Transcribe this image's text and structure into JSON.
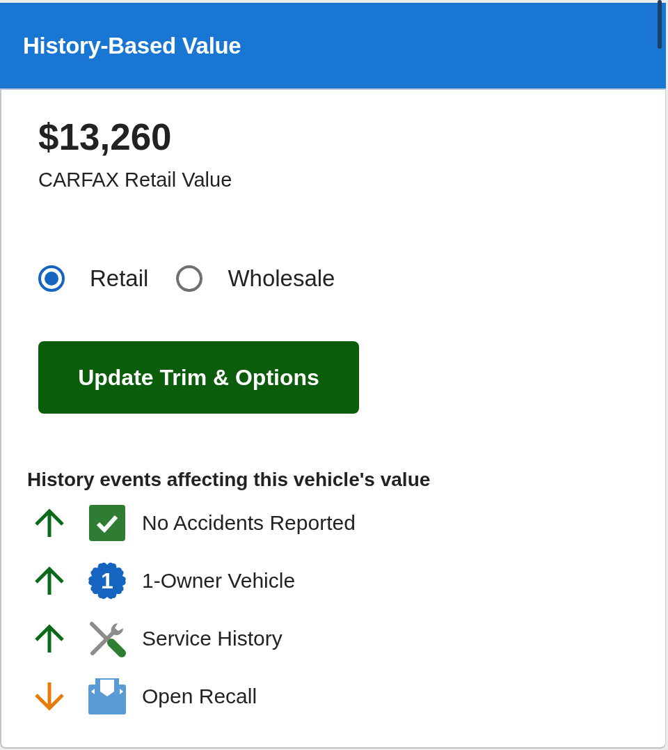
{
  "header": {
    "title": "History-Based Value"
  },
  "value": {
    "amount": "$13,260",
    "label": "CARFAX Retail Value"
  },
  "value_type_options": [
    {
      "label": "Retail",
      "selected": true
    },
    {
      "label": "Wholesale",
      "selected": false
    }
  ],
  "update_button": {
    "label": "Update Trim & Options"
  },
  "history": {
    "heading": "History events affecting this vehicle's value",
    "events": [
      {
        "label": "No Accidents Reported",
        "raises_value": true,
        "kind": "check"
      },
      {
        "label": "1-Owner Vehicle",
        "raises_value": true,
        "kind": "owner",
        "badge_text": "1"
      },
      {
        "label": "Service History",
        "raises_value": true,
        "kind": "service"
      },
      {
        "label": "Open Recall",
        "raises_value": false,
        "kind": "recall"
      }
    ]
  }
}
